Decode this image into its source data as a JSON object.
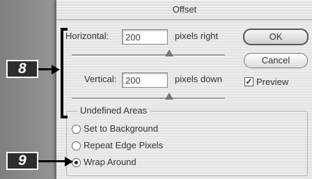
{
  "dialog": {
    "title": "Offset",
    "horizontal": {
      "label": "Horizontal:",
      "value": "200",
      "unit": "pixels right",
      "slider_fraction": 0.6
    },
    "vertical": {
      "label": "Vertical:",
      "value": "200",
      "unit": "pixels down",
      "slider_fraction": 0.6
    },
    "ok_label": "OK",
    "cancel_label": "Cancel",
    "preview": {
      "label": "Preview",
      "checked": true
    },
    "undefined_areas": {
      "title": "Undefined Areas",
      "options": [
        {
          "label": "Set to Background",
          "selected": false
        },
        {
          "label": "Repeat Edge Pixels",
          "selected": false
        },
        {
          "label": "Wrap Around",
          "selected": true
        }
      ]
    }
  },
  "callouts": {
    "first": "8",
    "second": "9"
  }
}
